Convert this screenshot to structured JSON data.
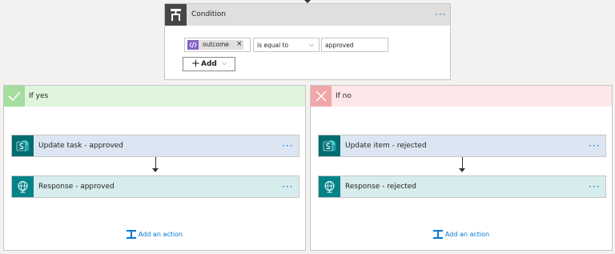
{
  "condition": {
    "title": "Condition",
    "menu": "···",
    "left_token": "outcome",
    "token_remove": "×",
    "operator": "is equal to",
    "operator_chevron": "⌵",
    "right_value": "approved",
    "add_plus": "+",
    "add_label": "Add",
    "add_chevron": "⌵"
  },
  "branches": [
    {
      "title": "If yes",
      "actions": [
        {
          "title": "Update task - approved",
          "menu": "···"
        },
        {
          "title": "Response - approved",
          "menu": "···"
        }
      ],
      "add_action": "Add an action"
    },
    {
      "title": "If no",
      "actions": [
        {
          "title": "Update item - rejected",
          "menu": "···"
        },
        {
          "title": "Response - rejected",
          "menu": "···"
        }
      ],
      "add_action": "Add an action"
    }
  ],
  "colors": {
    "accent": "#0078d4",
    "yes_header": "#dff6dd",
    "no_header": "#fde7e9",
    "sharepoint": "#036c70",
    "response": "#038387"
  }
}
